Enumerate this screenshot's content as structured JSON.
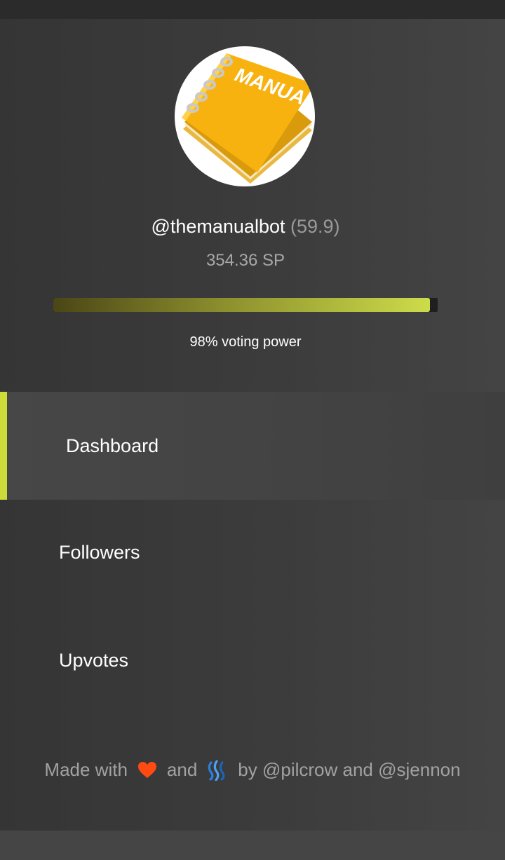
{
  "profile": {
    "avatar_icon": "manual-notebook-icon",
    "username": "@themanualbot",
    "reputation": "(59.9)",
    "steem_power": "354.36 SP",
    "voting_power_percent": 98,
    "voting_power_label": "98% voting power"
  },
  "nav": {
    "items": [
      {
        "label": "Dashboard",
        "active": true
      },
      {
        "label": "Followers",
        "active": false
      },
      {
        "label": "Upvotes",
        "active": false
      }
    ]
  },
  "footer": {
    "made_with": "Made with",
    "heart_icon": "heart-icon",
    "and": "and",
    "steem_icon": "steem-logo-icon",
    "by": "by @pilcrow and @sjennon"
  },
  "colors": {
    "accent": "#cddc39",
    "heart": "#ff4a12",
    "steem": "#4ba2f2"
  }
}
